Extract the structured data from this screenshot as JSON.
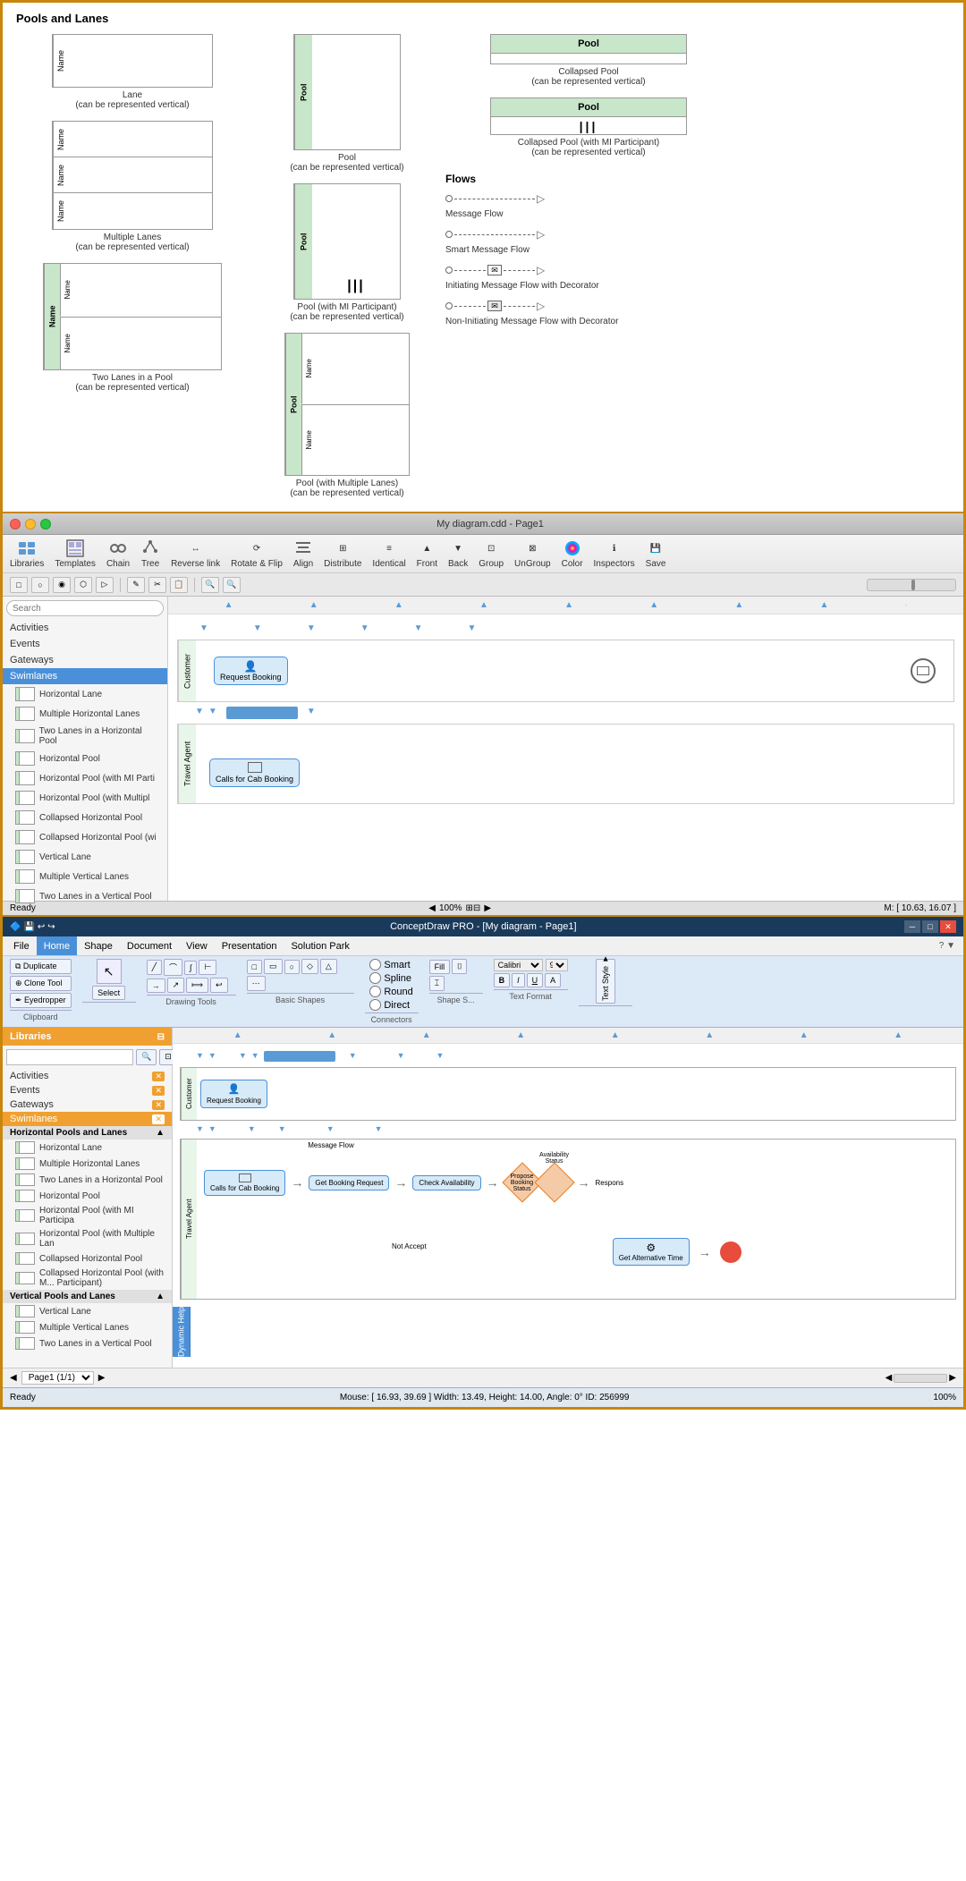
{
  "section1": {
    "title": "Pools and Lanes",
    "shapes": {
      "lane_name": "Name",
      "lane_label": "Lane\n(can be represented vertical)",
      "multiple_lanes_label": "Multiple Lanes\n(can be represented vertical)",
      "pool_label": "Pool\n(can be represented vertical)",
      "pool_mi_label": "Pool (with MI Participant)\n(can be represented vertical)",
      "pool_multilane_label": "Pool (with Multiple Lanes)\n(can be represented vertical)",
      "two_lanes_label": "Two Lanes in a Pool\n(can be represented vertical)",
      "collapsed_pool_label": "Collapsed Pool\n(can be represented vertical)",
      "collapsed_pool_mi_label": "Collapsed Pool (with MI Participant)\n(can be represented vertical)",
      "pool_header": "Pool"
    },
    "flows": {
      "title": "Flows",
      "message_flow_label": "Message Flow",
      "smart_message_flow_label": "Smart Message Flow",
      "initiating_label": "Initiating Message Flow with Decorator",
      "noninitiating_label": "Non-Initiating Message Flow with Decorator"
    }
  },
  "section2": {
    "title": "My diagram.cdd - Page1",
    "toolbar_items": [
      "Libraries",
      "Templates",
      "Chain",
      "Tree",
      "Reverse link",
      "Rotate & Flip",
      "Align",
      "Distribute",
      "Identical",
      "Front",
      "Back",
      "Group",
      "UnGroup",
      "Color",
      "Inspectors",
      "Save"
    ],
    "categories": [
      "Activities",
      "Events",
      "Gateways",
      "Swimlanes"
    ],
    "active_category": "Swimlanes",
    "list_items": [
      "Horizontal Lane",
      "Multiple Horizontal Lanes",
      "Two Lanes in a Horizontal Pool",
      "Horizontal Pool",
      "Horizontal Pool (with MI Parti",
      "Horizontal Pool (with Multipl",
      "Collapsed Horizontal Pool",
      "Collapsed Horizontal Pool (wi",
      "Vertical Lane",
      "Multiple Vertical Lanes",
      "Two Lanes in a Vertical Pool"
    ],
    "swimlanes": [
      {
        "label": "Customer",
        "content": "Request Booking"
      },
      {
        "label": "Travel Agent",
        "content": "Calls for Cab Booking"
      }
    ],
    "statusbar": "Ready",
    "zoom": "100%",
    "coordinates": "M: [ 10.63, 16.07 ]"
  },
  "section3": {
    "title": "ConceptDraw PRO - [My diagram - Page1]",
    "menu_items": [
      "File",
      "Home",
      "Shape",
      "Document",
      "View",
      "Presentation",
      "Solution Park"
    ],
    "active_menu": "Home",
    "ribbon_groups": {
      "clipboard": {
        "label": "Clipboard",
        "items": [
          "Duplicate",
          "Clone Tool",
          "Eyedropper"
        ]
      },
      "select": {
        "label": "",
        "items": [
          "Select"
        ]
      },
      "drawing_tools": {
        "label": "Drawing Tools"
      },
      "basic_shapes": {
        "label": "Basic Shapes"
      },
      "connectors": {
        "label": "Connectors",
        "items": [
          "Smart",
          "Spline",
          "Round",
          "Direct"
        ]
      },
      "shape_s": {
        "label": "Shape S..."
      },
      "text_format": {
        "label": "Text Format",
        "items": [
          "Calibri",
          "9"
        ]
      }
    },
    "round_label": "Round",
    "sidebar_title": "Libraries",
    "categories": [
      "Activities",
      "Events",
      "Gateways",
      "Swimlanes"
    ],
    "active_category": "Swimlanes",
    "section_headers": [
      "Horizontal Pools and Lanes",
      "Vertical Pools and Lanes"
    ],
    "list_items_horiz": [
      "Horizontal Lane",
      "Multiple Horizontal Lanes",
      "Two Lanes in a Horizontal Pool",
      "Horizontal Pool",
      "Horizontal Pool (with MI Participa",
      "Horizontal Pool (with Multiple Lan",
      "Collapsed Horizontal Pool",
      "Collapsed Horizontal Pool (with M... Participant)"
    ],
    "list_items_vert": [
      "Vertical Lane",
      "Multiple Vertical Lanes",
      "Two Lanes in a Vertical Pool"
    ],
    "swimlanes": [
      {
        "label": "Customer",
        "tasks": [
          "Request Booking"
        ]
      },
      {
        "label": "Travel Agent",
        "tasks": [
          "Calls for Cab Booking",
          "Get Booking Request",
          "Check Availability",
          "Propose Booking Status",
          "Get Alternative Time"
        ]
      }
    ],
    "statusbar_left": "Ready",
    "statusbar_center": "Mouse: [ 16.93, 39.69 ]    Width: 13.49, Height: 14.00, Angle: 0°    ID: 256999",
    "statusbar_right": "100%",
    "pagebar": "Page1 (1/1)",
    "dynamic_help": "Dynamic Help"
  }
}
